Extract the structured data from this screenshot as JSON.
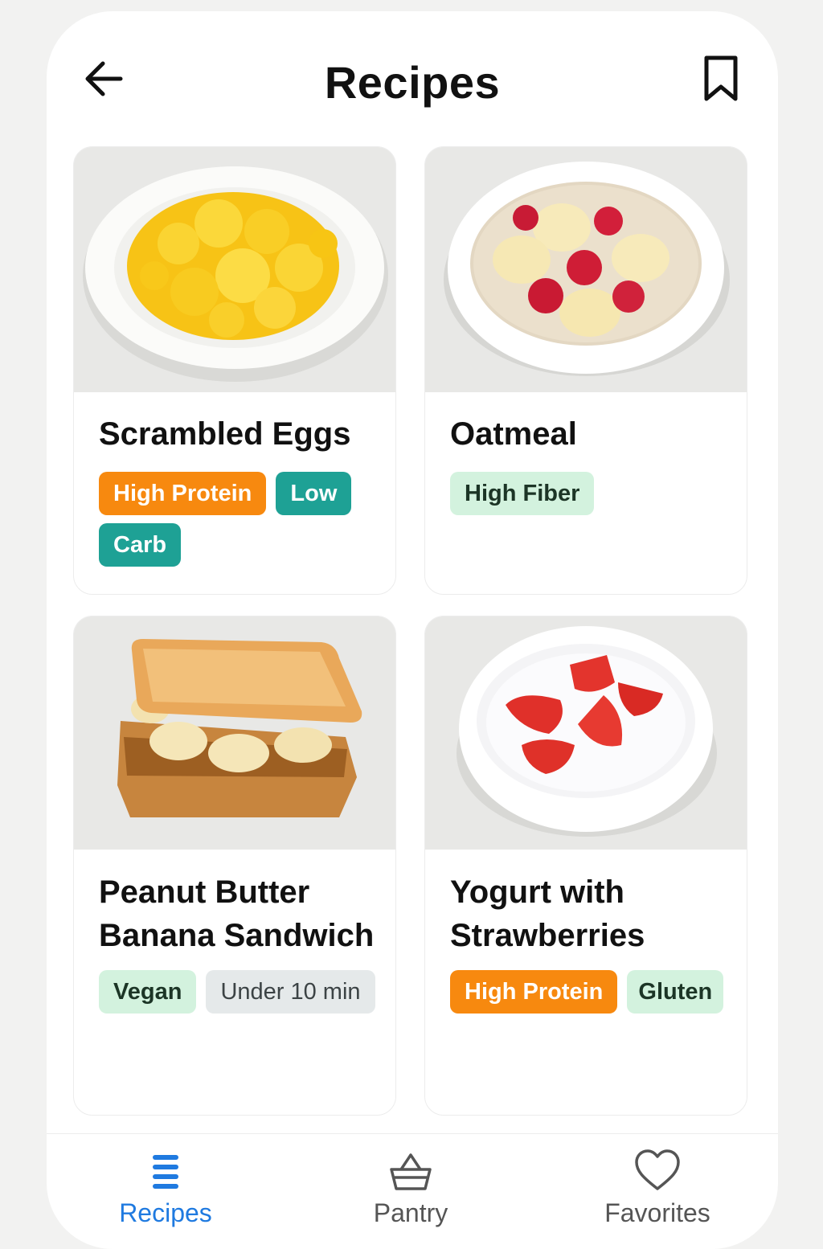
{
  "header": {
    "title": "Recipes",
    "back_icon": "arrow-left-icon",
    "bookmark_icon": "bookmark-icon"
  },
  "recipes": [
    {
      "title": "Scrambled Eggs",
      "image": "scrambled-eggs-plate",
      "tags": [
        {
          "label": "High Protein",
          "color": "#f7890f"
        },
        {
          "label": "Low",
          "color": "#1ea195"
        },
        {
          "label": "Carb",
          "color": "#1ea195"
        }
      ]
    },
    {
      "title": "Oatmeal",
      "image": "oatmeal-bowl-with-banana-and-raspberries",
      "tags": [
        {
          "label": "High Fiber",
          "color": "#d3f2de"
        }
      ]
    },
    {
      "title": "Peanut Butter Banana Sandwich",
      "image": "peanut-butter-banana-toast-sandwich",
      "tags": [
        {
          "label": "Vegan",
          "color": "#d3f2de"
        },
        {
          "label": "Under 10 min",
          "color": "#e5e9ea"
        }
      ]
    },
    {
      "title": "Yogurt with Strawberries",
      "image": "yogurt-bowl-with-strawberries",
      "tags": [
        {
          "label": "High Protein",
          "color": "#f7890f"
        },
        {
          "label": "Gluten",
          "color": "#d3f2de"
        }
      ]
    }
  ],
  "tab_bar": {
    "active": "Recipes",
    "active_color": "#1f7ae0",
    "tabs": [
      {
        "label": "Recipes",
        "icon": "list-icon"
      },
      {
        "label": "Pantry",
        "icon": "basket-icon"
      },
      {
        "label": "Favorites",
        "icon": "heart-icon"
      }
    ]
  }
}
